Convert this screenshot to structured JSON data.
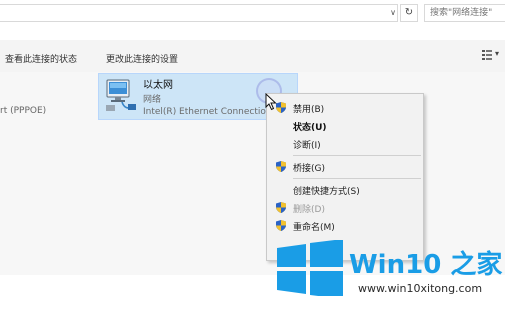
{
  "address_bar": {
    "search_placeholder": "搜索\"网络连接\"",
    "dropdown_glyph": "∨",
    "refresh_glyph": "↻"
  },
  "command_bar": {
    "view_status": "查看此连接的状态",
    "change_settings": "更改此连接的设置",
    "view_dropdown_glyph": "▾"
  },
  "connections": {
    "pppoe_label": "rt (PPPOE)",
    "ethernet": {
      "name": "以太网",
      "status": "网络",
      "device": "Intel(R) Ethernet Connection"
    }
  },
  "context_menu": {
    "items": [
      {
        "label": "禁用(B)",
        "icon": "uac-shield-icon",
        "style": "normal"
      },
      {
        "label": "状态(U)",
        "icon": "",
        "style": "bold"
      },
      {
        "label": "诊断(I)",
        "icon": "",
        "style": "normal"
      },
      {
        "label": "桥接(G)",
        "icon": "uac-shield-icon",
        "style": "normal"
      },
      {
        "label": "创建快捷方式(S)",
        "icon": "",
        "style": "normal"
      },
      {
        "label": "删除(D)",
        "icon": "uac-shield-icon",
        "style": "disabled"
      },
      {
        "label": "重命名(M)",
        "icon": "uac-shield-icon",
        "style": "normal"
      }
    ]
  },
  "watermark": {
    "brand": "Win10 之家",
    "url": "www.win10xitong.com",
    "colors": {
      "blue": "#1a9de6"
    }
  }
}
